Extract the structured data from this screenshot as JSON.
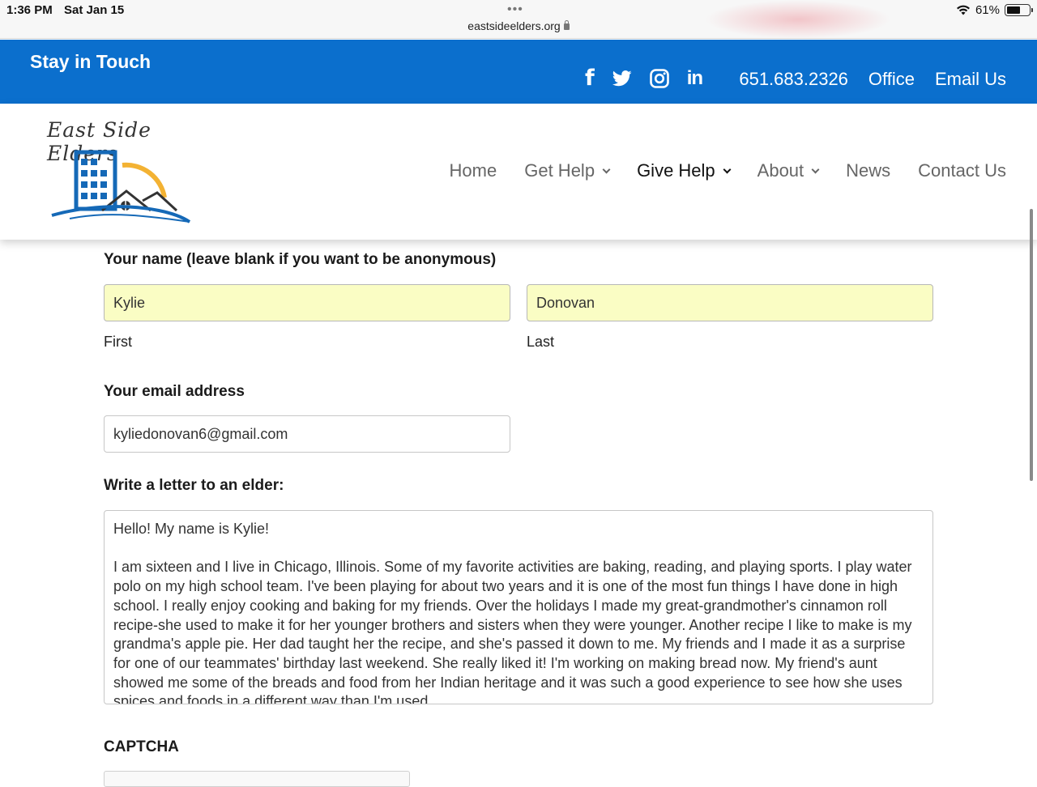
{
  "status": {
    "time": "1:36 PM",
    "date": "Sat Jan 15",
    "url": "eastsideelders.org",
    "battery": "61%",
    "battery_level": 0.61
  },
  "topbar": {
    "title": "Stay in Touch",
    "social": [
      "facebook-icon",
      "twitter-icon",
      "instagram-icon",
      "linkedin-icon"
    ],
    "linkedin_text": "in",
    "facebook_text": "f",
    "phone": "651.683.2326",
    "office": "Office",
    "email": "Email Us",
    "color": "#0b6fcd"
  },
  "header": {
    "logo_text": "East Side Elders",
    "nav": [
      {
        "label": "Home",
        "dropdown": false
      },
      {
        "label": "Get Help",
        "dropdown": true
      },
      {
        "label": "Give Help",
        "dropdown": true,
        "active": true
      },
      {
        "label": "About",
        "dropdown": true
      },
      {
        "label": "News",
        "dropdown": false
      },
      {
        "label": "Contact Us",
        "dropdown": false
      }
    ]
  },
  "form": {
    "name_label": "Your name (leave blank if you want to be anonymous)",
    "first_value": "Kylie",
    "last_value": "Donovan",
    "first_sublabel": "First",
    "last_sublabel": "Last",
    "email_label": "Your email address",
    "email_value": "kyliedonovan6@gmail.com",
    "letter_label": "Write a letter to an elder:",
    "letter_value": "Hello! My name is Kylie!\n\nI am sixteen and I live in Chicago, Illinois. Some of my favorite activities are baking, reading, and playing sports. I play water polo on my high school team. I've been playing for about two years and it is one of the most fun things I have done in high school. I really enjoy cooking and baking for my friends. Over the holidays I made my great-grandmother's cinnamon roll recipe-she used to make it for her younger brothers and sisters when they were younger. Another recipe I like to make is my grandma's apple pie. Her dad taught her the recipe, and she's passed it down to me. My friends and I made it as a surprise for one of our teammates' birthday last weekend. She really liked it! I'm working on making bread now. My friend's aunt showed me some of the breads and food from her Indian heritage and it was such a good experience to see how she uses spices and foods in a different way than I'm used",
    "captcha_label": "CAPTCHA",
    "autofill_color": "#fafdc4"
  }
}
